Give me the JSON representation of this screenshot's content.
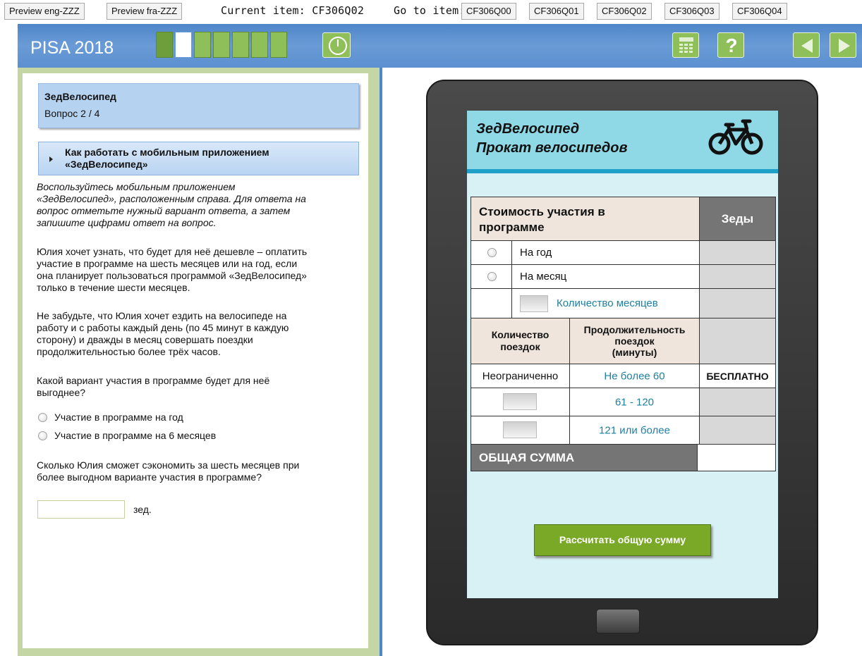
{
  "topbar": {
    "preview_eng": "Preview eng-ZZZ",
    "preview_fra": "Preview fra-ZZZ",
    "current_label": "Current item:",
    "current_value": "CF306Q02",
    "goto_label": "Go to item:",
    "items": [
      "CF306Q00",
      "CF306Q01",
      "CF306Q02",
      "CF306Q03",
      "CF306Q04"
    ]
  },
  "header": {
    "title": "PISA 2018",
    "progress": {
      "total": 7,
      "current": 2
    },
    "icons": [
      "timer-icon",
      "calculator-icon",
      "help-icon",
      "back-arrow-icon",
      "next-arrow-icon"
    ]
  },
  "left": {
    "unit_title": "ЗедВелосипед",
    "unit_question": "Вопрос 2 / 4",
    "howto_line1": "Как работать с мобильным приложением",
    "howto_line2": "«ЗедВелосипед»",
    "instructions": [
      "Воспользуйтесь мобильным приложением",
      "«ЗедВелосипед», расположенным справа. Для ответа на",
      "вопрос отметьте нужный вариант ответа, а затем",
      "запишите цифрами ответ на вопрос."
    ],
    "para1": [
      "Юлия хочет узнать, что будет для неё дешевле – оплатить",
      "участие в программе на шесть месяцев или на год, если",
      "она планирует пользоваться программой «ЗедВелосипед»",
      "только в течение шести месяцев."
    ],
    "para2": [
      "Не забудьте, что Юлия хочет ездить на велосипеде на",
      "работу и с работы каждый день (по 45 минут в каждую",
      "сторону) и дважды в месяц совершать поездки",
      "продолжительностью более трёх часов."
    ],
    "question1": [
      "Какой вариант участия в программе будет для неё",
      "выгоднее?"
    ],
    "options": [
      "Участие в программе на год",
      "Участие в программе на 6 месяцев"
    ],
    "question2": [
      "Сколько Юлия сможет сэкономить за шесть месяцев при",
      "более выгодном варианте участия в программе?"
    ],
    "answer_unit": "зед."
  },
  "app": {
    "title_line1": "ЗедВелосипед",
    "title_line2": "Прокат велосипедов",
    "cost_header": "Стоимость участия в программе",
    "cost_header_l1": "Стоимость участия в",
    "cost_header_l2": "программе",
    "zeds_header": "Зеды",
    "option_year": "На год",
    "option_month": "На месяц",
    "months_count": "Количество месяцев",
    "trips_header_l1": "Количество",
    "trips_header_l2": "поездок",
    "duration_header_l1": "Продолжительность",
    "duration_header_l2": "поездок",
    "duration_header_l3": "(минуты)",
    "row1_trips": "Неограниченно",
    "row1_duration": "Не более 60",
    "row1_price": "БЕСПЛАТНО",
    "row2_duration": "61 - 120",
    "row3_duration": "121 или более",
    "total_label": "ОБЩАЯ СУММА",
    "calc_button": "Рассчитать общую сумму"
  }
}
